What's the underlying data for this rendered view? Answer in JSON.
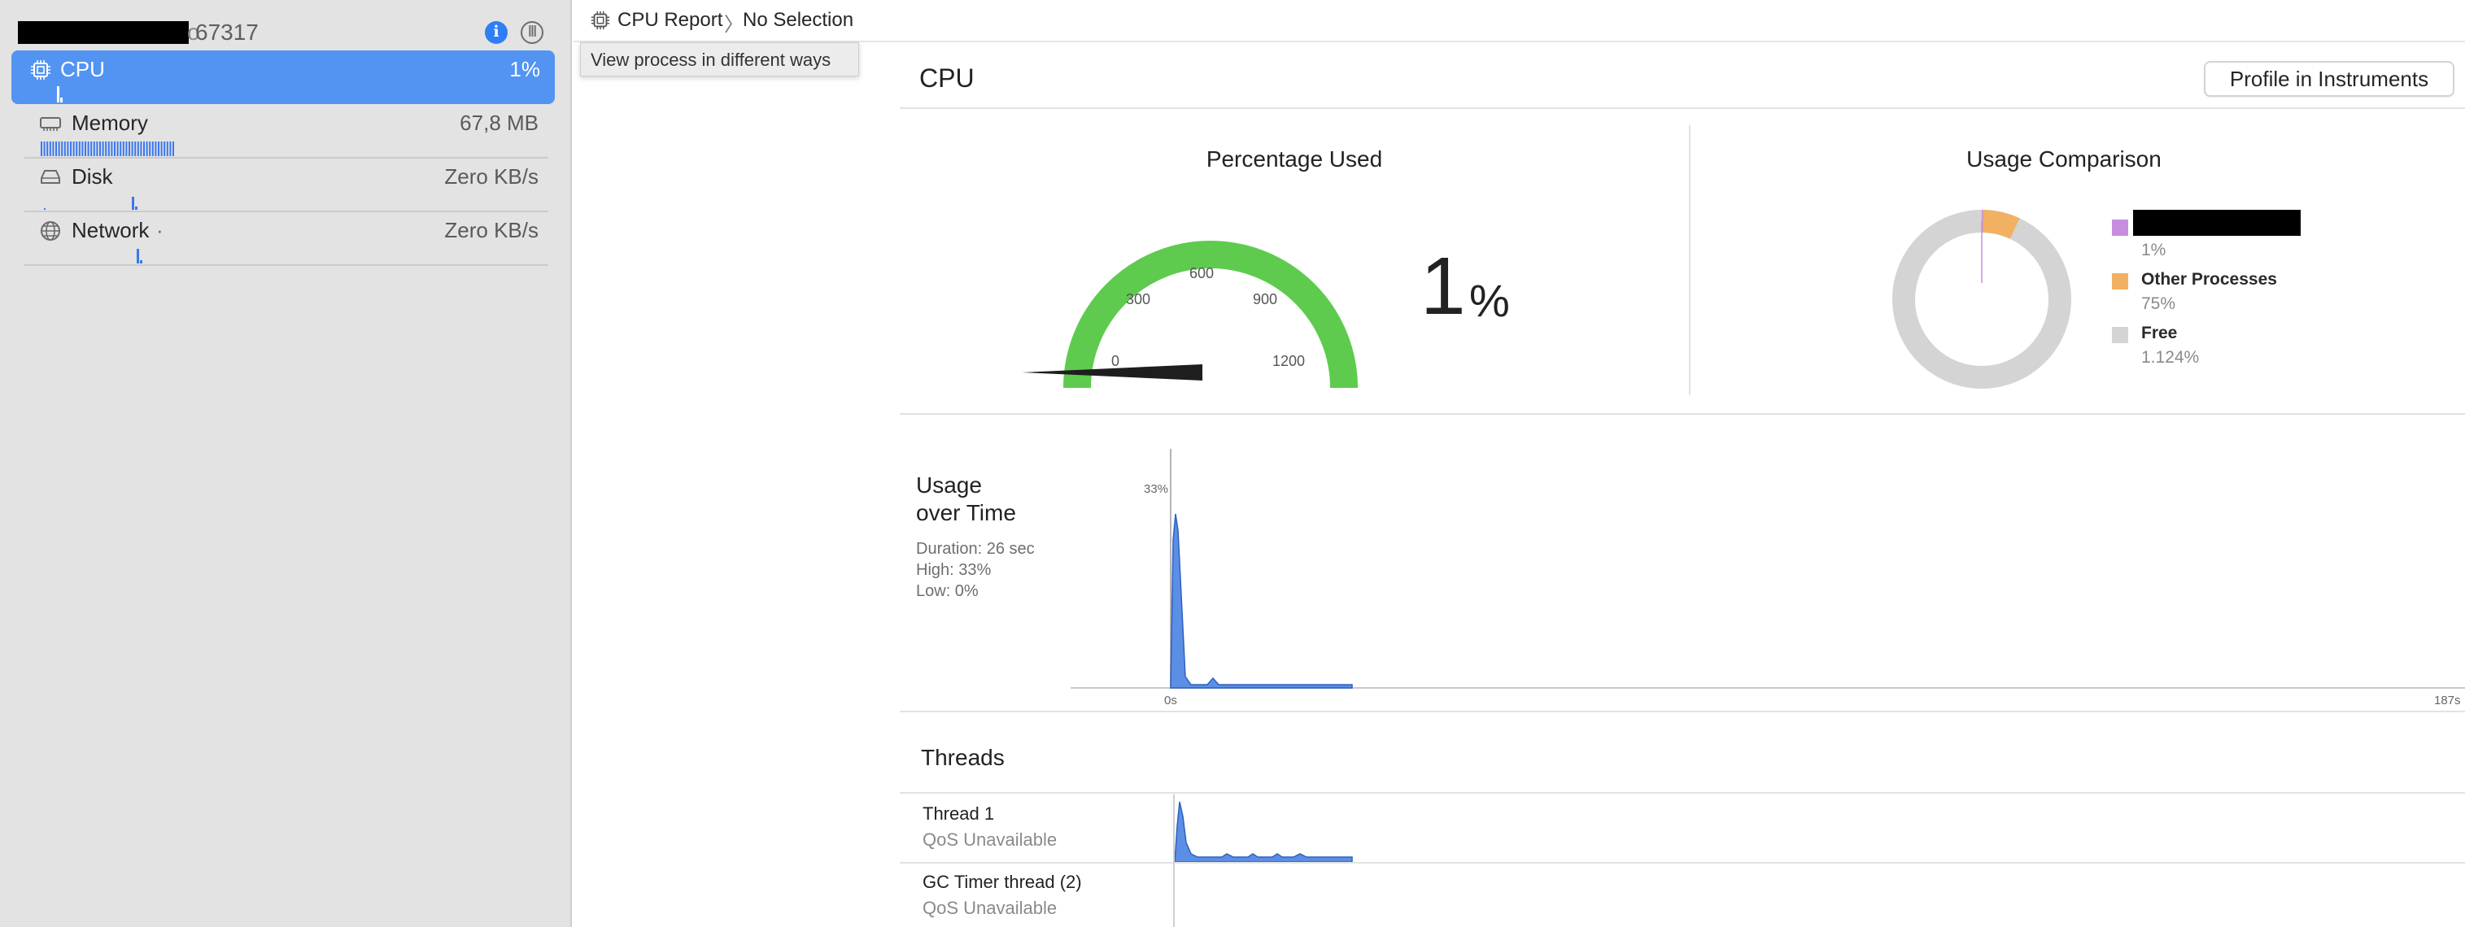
{
  "process": {
    "redacted_tail": "o",
    "pid": "67317",
    "info_icon": "info-icon",
    "sample_icon": "sample-icon"
  },
  "sidebar": {
    "items": [
      {
        "label": "CPU",
        "value": "1%",
        "icon": "cpu-icon",
        "selected": true
      },
      {
        "label": "Memory",
        "value": "67,8 MB",
        "icon": "memory-icon",
        "selected": false
      },
      {
        "label": "Disk",
        "value": "Zero KB/s",
        "icon": "disk-icon",
        "selected": false
      },
      {
        "label": "Network",
        "value": "Zero KB/s",
        "icon": "network-icon",
        "selected": false
      }
    ]
  },
  "jumpbar": {
    "crumb1": "CPU Report",
    "separator": "〉",
    "crumb2": "No Selection",
    "tooltip": "View process in different ways"
  },
  "report": {
    "title": "CPU",
    "profile_button": "Profile in Instruments",
    "percentage_used": {
      "heading": "Percentage Used",
      "value": "1",
      "unit": "%",
      "gauge_ticks": [
        "0",
        "300",
        "600",
        "900",
        "1200"
      ],
      "gauge_max": 1200,
      "gauge_value": 1
    },
    "usage_comparison": {
      "heading": "Usage Comparison",
      "legend": [
        {
          "label": "",
          "value": "1%",
          "color": "#c58ee0",
          "redacted": true
        },
        {
          "label": "Other Processes",
          "value": "75%",
          "color": "#f2b063",
          "redacted": false
        },
        {
          "label": "Free",
          "value": "1.124%",
          "color": "#d4d4d4",
          "redacted": false
        }
      ]
    },
    "usage_over_time": {
      "title_line1": "Usage",
      "title_line2": "over Time",
      "duration": "Duration: 26 sec",
      "high": "High: 33%",
      "low": "Low: 0%",
      "y_label": "33%",
      "x_start": "0s",
      "x_end": "187s"
    },
    "threads": {
      "title": "Threads",
      "items": [
        {
          "name": "Thread 1",
          "qos": "QoS Unavailable"
        },
        {
          "name": "GC Timer thread (2)",
          "qos": "QoS Unavailable"
        }
      ]
    }
  },
  "colors": {
    "accent": "#5394f3",
    "graph_fill": "#5b8fe6",
    "gauge_green": "#5ecb4f"
  }
}
